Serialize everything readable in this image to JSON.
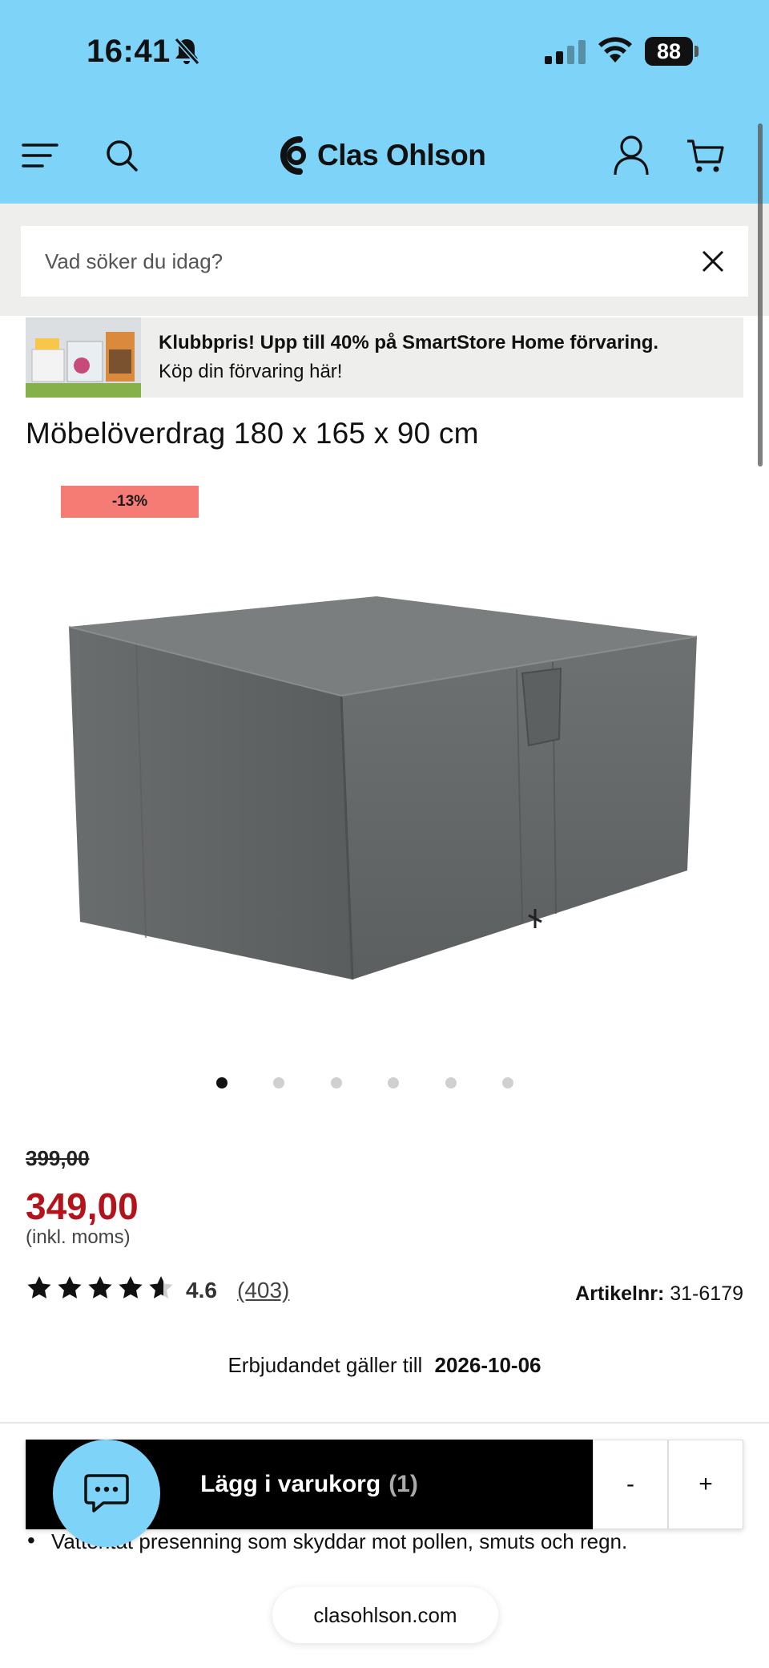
{
  "status_bar": {
    "time": "16:41",
    "battery": "88",
    "icons": [
      "bell-slash-icon",
      "signal-icon",
      "wifi-icon",
      "battery-icon"
    ]
  },
  "header": {
    "logo_text": "Clas Ohlson",
    "icons": [
      "menu-icon",
      "search-icon",
      "logo-icon",
      "account-icon",
      "cart-icon"
    ]
  },
  "search": {
    "placeholder": "Vad söker du idag?",
    "value": ""
  },
  "promo": {
    "headline": "Klubbpris! Upp till 40% på SmartStore Home förvaring.",
    "subline": "Köp din förvaring här!"
  },
  "product": {
    "title": "Möbelöverdrag 180 x 165 x 90 cm",
    "discount_badge": "-13%",
    "old_price": "399,00",
    "price": "349,00",
    "vat_note": "(inkl. moms)",
    "rating": "4.6",
    "rating_value": 4.6,
    "rating_max": 5,
    "reviews": "(403)",
    "article_label": "Artikelnr:",
    "article_number": "31-6179",
    "offer_label": "Erbjudandet gäller till",
    "offer_date": "2026-10-06",
    "bullet": "Vattentät presenning som skyddar mot pollen, smuts och regn."
  },
  "carousel": {
    "count": 6,
    "active_index": 0
  },
  "cart_bar": {
    "add_label": "Lägg i varukorg",
    "count": "(1)",
    "minus": "-",
    "plus": "+"
  },
  "browser": {
    "url": "clasohlson.com"
  },
  "colors": {
    "brand_blue": "#7dd3f8",
    "price_red": "#b3141c",
    "badge_red": "#f47c74"
  }
}
